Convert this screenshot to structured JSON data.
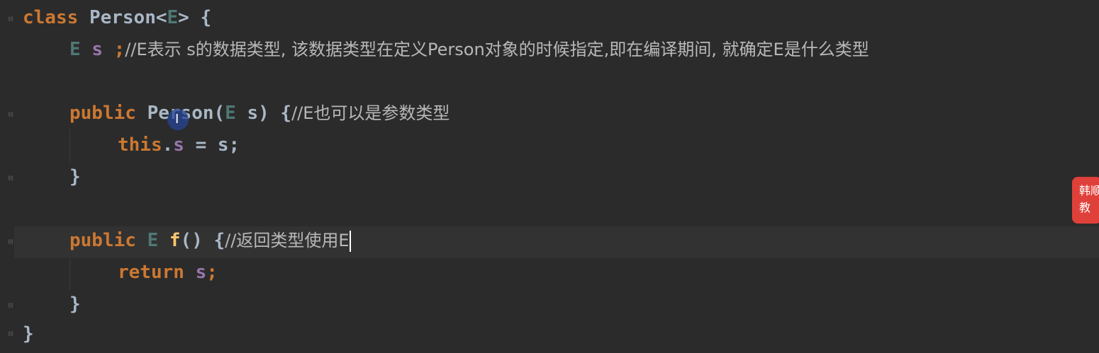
{
  "code": {
    "line1": {
      "kw": "class",
      "name": "Person",
      "lt": "<",
      "typ": "E",
      "rest": "> {"
    },
    "line2": {
      "typ": "E",
      "field": "s",
      "semi": ";",
      "comment": "//E表示 s的数据类型, 该数据类型在定义Person对象的时候指定,即在编译期间, 就确定E是什么类型"
    },
    "line3": {
      "kw": "public",
      "name": "Person",
      "open": "(",
      "typ": "E",
      "param": " s) {",
      "comment": "//E也可以是参数类型"
    },
    "line4": {
      "kw": "this",
      "dot": ".",
      "field": "s",
      "rest": " = s;"
    },
    "line5": {
      "brace": "}"
    },
    "line6": {
      "kw": "public",
      "typ": "E",
      "fname": "f",
      "rest": "() {",
      "comment": "//返回类型使用E"
    },
    "line7": {
      "kw": "return",
      "field": "s",
      "semi": ";"
    },
    "line8": {
      "brace": "}"
    },
    "line9": {
      "brace": "}"
    }
  },
  "badge": {
    "text1": "韩顺",
    "text2": "教"
  },
  "cursor_glyph": "I",
  "colors": {
    "background": "#2b2b2b",
    "keyword": "#cc7832",
    "type_param": "#507874",
    "field": "#9876aa",
    "comment": "#b8b8b8"
  }
}
